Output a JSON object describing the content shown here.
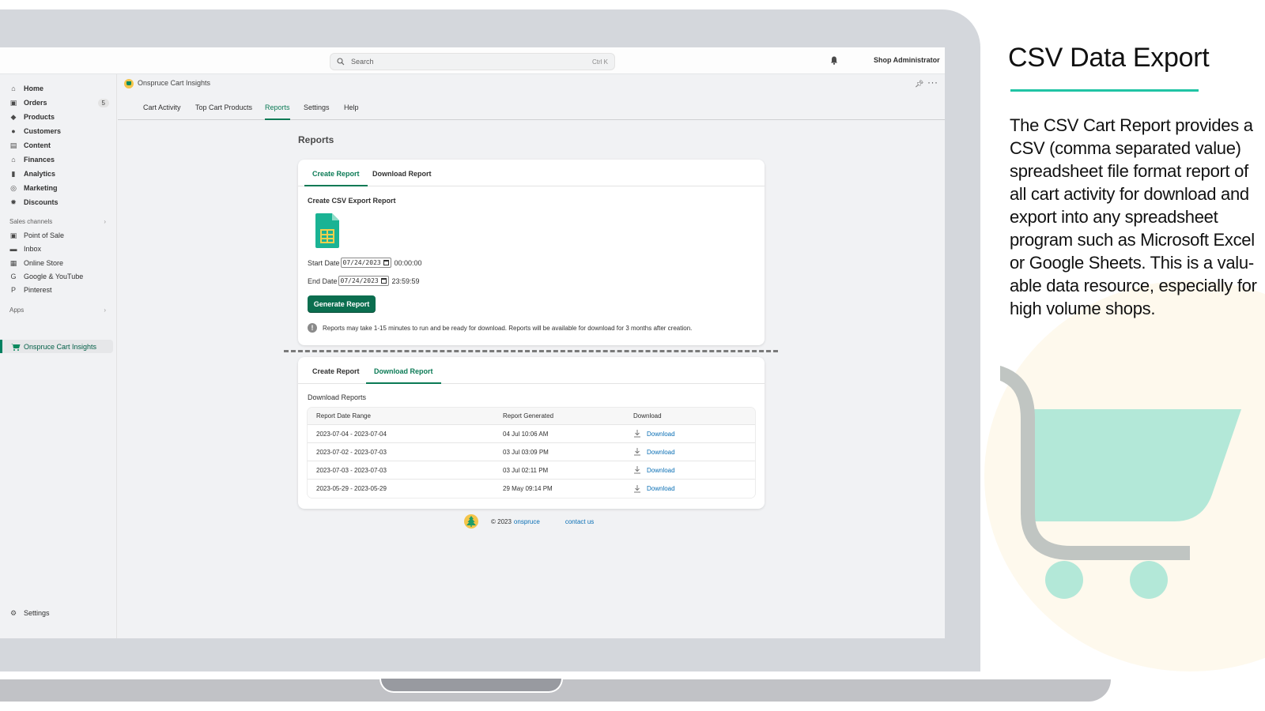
{
  "topbar": {
    "search_placeholder": "Search",
    "search_shortcut": "Ctrl K",
    "user_name": "Shop Administrator"
  },
  "sidebar": {
    "items": [
      {
        "label": "Home",
        "icon": "home-icon"
      },
      {
        "label": "Orders",
        "icon": "orders-icon",
        "badge": "5"
      },
      {
        "label": "Products",
        "icon": "tag-icon"
      },
      {
        "label": "Customers",
        "icon": "person-icon"
      },
      {
        "label": "Content",
        "icon": "content-icon"
      },
      {
        "label": "Finances",
        "icon": "bank-icon"
      },
      {
        "label": "Analytics",
        "icon": "bar-chart-icon"
      },
      {
        "label": "Marketing",
        "icon": "target-icon"
      },
      {
        "label": "Discounts",
        "icon": "discount-icon"
      }
    ],
    "sales_channels_label": "Sales channels",
    "sales_channels": [
      {
        "label": "Point of Sale",
        "icon": "pos-icon"
      },
      {
        "label": "Inbox",
        "icon": "inbox-icon"
      },
      {
        "label": "Online Store",
        "icon": "store-icon"
      },
      {
        "label": "Google & YouTube",
        "icon": "google-icon"
      },
      {
        "label": "Pinterest",
        "icon": "pinterest-icon"
      }
    ],
    "apps_label": "Apps",
    "active_app": "Onspruce Cart Insights",
    "settings_label": "Settings"
  },
  "app": {
    "name": "Onspruce Cart Insights",
    "tabs": [
      "Cart Activity",
      "Top Cart Products",
      "Reports",
      "Settings",
      "Help"
    ],
    "active_tab": "Reports"
  },
  "page": {
    "title": "Reports"
  },
  "create_card": {
    "tabs": [
      "Create Report",
      "Download Report"
    ],
    "active_tab": "Create Report",
    "section_title": "Create CSV Export Report",
    "start_label": "Start Date",
    "start_date": "07/24/2023",
    "start_time": "00:00:00",
    "end_label": "End Date",
    "end_date": "07/24/2023",
    "end_time": "23:59:59",
    "button_label": "Generate Report",
    "notice": "Reports may take 1-15 minutes to run and be ready for download. Reports will be available for download for 3 months after creation."
  },
  "download_card": {
    "tabs": [
      "Create Report",
      "Download Report"
    ],
    "active_tab": "Download Report",
    "section_title": "Download Reports",
    "columns": [
      "Report Date Range",
      "Report Generated",
      "Download"
    ],
    "rows": [
      {
        "range": "2023-07-04 - 2023-07-04",
        "generated": "04 Jul 10:06 AM",
        "link": "Download"
      },
      {
        "range": "2023-07-02 - 2023-07-03",
        "generated": "03 Jul 03:09 PM",
        "link": "Download"
      },
      {
        "range": "2023-07-03 - 2023-07-03",
        "generated": "03 Jul 02:11 PM",
        "link": "Download"
      },
      {
        "range": "2023-05-29 - 2023-05-29",
        "generated": "29 May 09:14 PM",
        "link": "Download"
      }
    ]
  },
  "footer": {
    "copyright": "© 2023",
    "brand": "onspruce",
    "contact": "contact us"
  },
  "marketing": {
    "title": "CSV Data Export",
    "body": "The CSV Cart Report provides a CSV (comma separated value) spreadsheet file format report of all cart activity for download and export into any spreadsheet program such as Microsoft Excel or Google Sheets.  This is a valu-able data resource, especially for high volume shops.",
    "accent_color": "#20c4a4",
    "cart_color": "#b3e8d8"
  },
  "colors": {
    "primary": "#0b6e4f",
    "link": "#0a6fb5",
    "active_tab": "#0b7a55"
  }
}
